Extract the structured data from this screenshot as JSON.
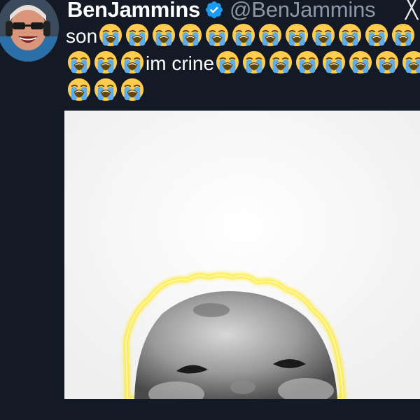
{
  "tweet": {
    "author": {
      "display_name": "BenJammins",
      "handle": "@BenJammins",
      "verified": true,
      "verified_icon": "verified-badge-icon"
    },
    "close_icon": "close-icon",
    "close_glyph": "╳",
    "text_segments": [
      {
        "type": "text",
        "value": "son"
      },
      {
        "type": "emoji",
        "value": "😭"
      },
      {
        "type": "emoji",
        "value": "😭"
      },
      {
        "type": "emoji",
        "value": "😭"
      },
      {
        "type": "emoji",
        "value": "😭"
      },
      {
        "type": "emoji",
        "value": "😭"
      },
      {
        "type": "emoji",
        "value": "😭"
      },
      {
        "type": "emoji",
        "value": "😭"
      },
      {
        "type": "emoji",
        "value": "😭"
      },
      {
        "type": "emoji",
        "value": "😭"
      },
      {
        "type": "emoji",
        "value": "😭"
      },
      {
        "type": "emoji",
        "value": "😭"
      },
      {
        "type": "emoji",
        "value": "😭"
      },
      {
        "type": "emoji",
        "value": "😭"
      },
      {
        "type": "emoji",
        "value": "😭"
      },
      {
        "type": "emoji",
        "value": "😭"
      },
      {
        "type": "text",
        "value": "im crine"
      },
      {
        "type": "emoji",
        "value": "😭"
      },
      {
        "type": "emoji",
        "value": "😭"
      },
      {
        "type": "emoji",
        "value": "😭"
      },
      {
        "type": "emoji",
        "value": "😭"
      },
      {
        "type": "emoji",
        "value": "😭"
      },
      {
        "type": "emoji",
        "value": "😭"
      },
      {
        "type": "emoji",
        "value": "😭"
      },
      {
        "type": "emoji",
        "value": "😭"
      },
      {
        "type": "emoji",
        "value": "😭"
      },
      {
        "type": "emoji",
        "value": "😭"
      },
      {
        "type": "emoji",
        "value": "😭"
      }
    ],
    "media": {
      "kind": "image",
      "subject": "baby-face-with-yellow-glow"
    }
  },
  "colors": {
    "background": "#131a26",
    "name": "#ffffff",
    "handle": "#8b98a5",
    "verified": "#1d9bf0",
    "glow": "#ffe600"
  }
}
